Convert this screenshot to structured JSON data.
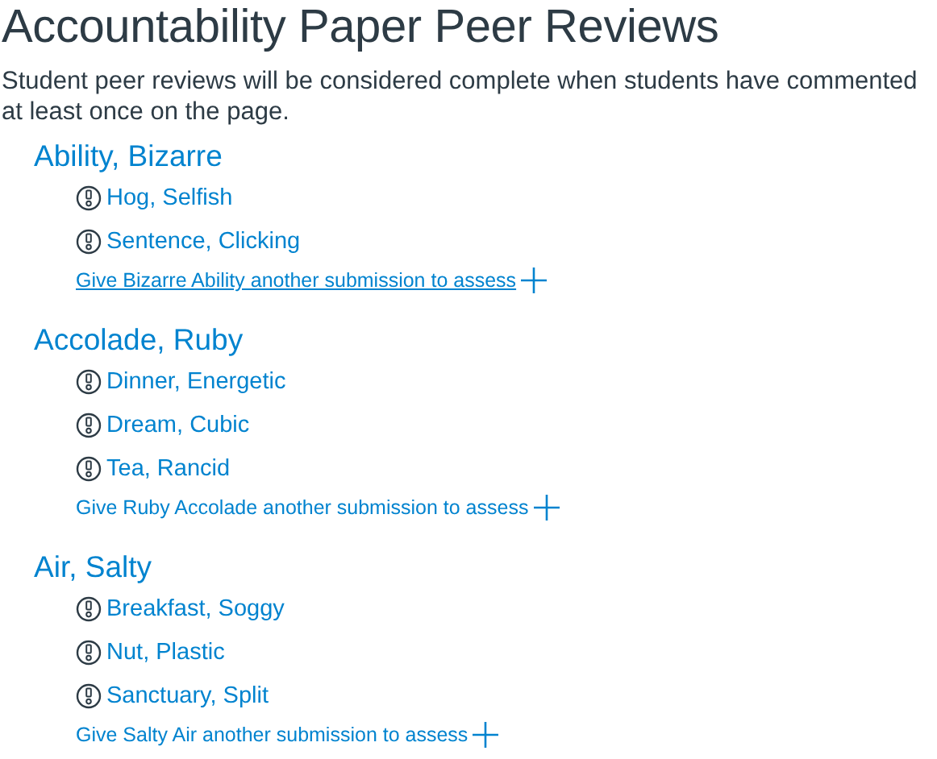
{
  "title": "Accountability Paper Peer Reviews",
  "description": "Student peer reviews will be considered complete when students have commented at least once on the page.",
  "reviewers": [
    {
      "name": "Ability, Bizarre",
      "assessments": [
        "Hog, Selfish",
        "Sentence, Clicking"
      ],
      "assign_link": {
        "label": "Give Bizarre Ability another submission to assess",
        "hovered": true
      }
    },
    {
      "name": "Accolade, Ruby",
      "assessments": [
        "Dinner, Energetic",
        "Dream, Cubic",
        "Tea, Rancid"
      ],
      "assign_link": {
        "label": "Give Ruby Accolade another submission to assess",
        "hovered": false
      }
    },
    {
      "name": "Air, Salty",
      "assessments": [
        "Breakfast, Soggy",
        "Nut, Plastic",
        "Sanctuary, Split"
      ],
      "assign_link": {
        "label": "Give Salty Air another submission to assess",
        "hovered": false
      }
    }
  ]
}
